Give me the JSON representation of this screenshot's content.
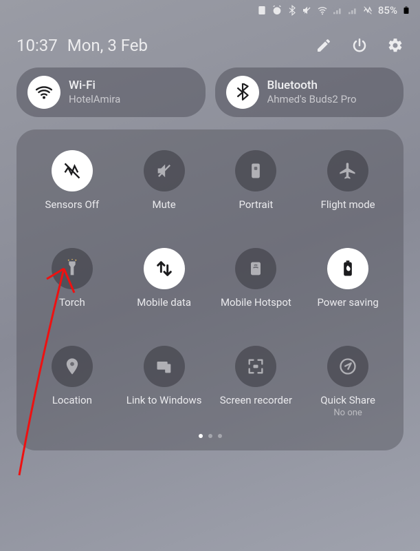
{
  "status_bar": {
    "battery_text": "85%"
  },
  "header": {
    "time": "10:37",
    "date": "Mon, 3 Feb"
  },
  "pills": {
    "wifi": {
      "title": "Wi-Fi",
      "subtitle": "HotelAmira"
    },
    "bluetooth": {
      "title": "Bluetooth",
      "subtitle": "Ahmed's Buds2 Pro"
    }
  },
  "tiles": {
    "sensors_off": {
      "label": "Sensors Off",
      "active": true
    },
    "mute": {
      "label": "Mute",
      "active": false
    },
    "portrait": {
      "label": "Portrait",
      "active": false
    },
    "flight_mode": {
      "label": "Flight mode",
      "active": false
    },
    "torch": {
      "label": "Torch",
      "active": false
    },
    "mobile_data": {
      "label": "Mobile data",
      "active": true
    },
    "mobile_hotspot": {
      "label": "Mobile Hotspot",
      "active": false
    },
    "power_saving": {
      "label": "Power saving",
      "active": true
    },
    "location": {
      "label": "Location",
      "active": false
    },
    "link_windows": {
      "label": "Link to Windows",
      "active": false
    },
    "screen_recorder": {
      "label": "Screen recorder",
      "active": false
    },
    "quick_share": {
      "label": "Quick Share",
      "sub": "No one",
      "active": false
    }
  },
  "pager": {
    "total": 3,
    "active": 0
  }
}
